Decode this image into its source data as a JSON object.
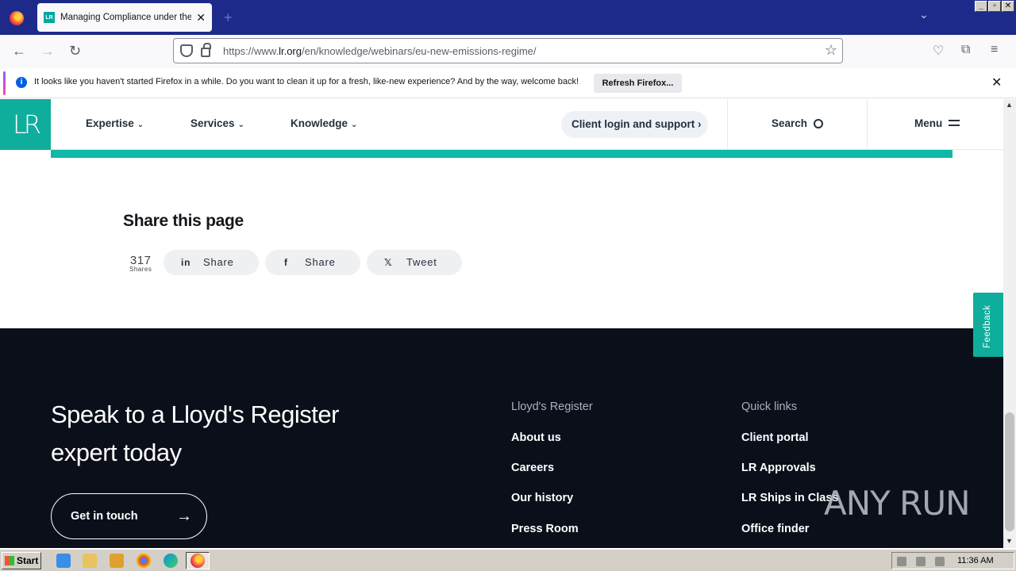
{
  "browser": {
    "tab_title": "Managing Compliance under the EU",
    "tab_favicon": "LR",
    "url_prefix": "https://www.",
    "url_domain": "lr.org",
    "url_path": "/en/knowledge/webinars/eu-new-emissions-regime/",
    "notification": {
      "message": "It looks like you haven't started Firefox in a while. Do you want to clean it up for a fresh, like-new experience? And by the way, welcome back!",
      "button": "Refresh Firefox..."
    }
  },
  "site": {
    "logo": "LR",
    "nav": {
      "expertise": "Expertise",
      "services": "Services",
      "knowledge": "Knowledge",
      "client_login": "Client login and support",
      "search": "Search",
      "menu": "Menu"
    },
    "share": {
      "title": "Share this page",
      "count": "317",
      "count_label": "Shares",
      "linkedin": "Share",
      "facebook": "Share",
      "twitter": "Tweet"
    },
    "footer": {
      "heading": "Speak to a Lloyd's Register expert today",
      "cta": "Get in touch",
      "col1": {
        "title": "Lloyd's Register",
        "links": [
          "About us",
          "Careers",
          "Our history",
          "Press Room"
        ]
      },
      "col2": {
        "title": "Quick links",
        "links": [
          "Client portal",
          "LR Approvals",
          "LR Ships in Class",
          "Office finder"
        ]
      }
    },
    "feedback": "Feedback"
  },
  "watermark": "ANY RUN",
  "taskbar": {
    "start": "Start",
    "clock": "11:36 AM"
  },
  "colors": {
    "brand_teal": "#0fae9c",
    "footer_bg": "#0b0f1a",
    "tabbar_bg": "#1e2a8a"
  }
}
